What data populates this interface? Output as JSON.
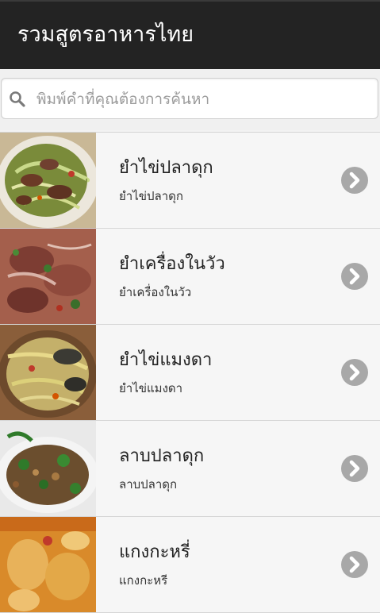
{
  "header": {
    "title": "รวมสูตรอาหารไทย"
  },
  "search": {
    "placeholder": "พิมพ์คำที่คุณต้องการค้นหา",
    "icon": "search-icon"
  },
  "recipes": [
    {
      "title": "ยำไข่ปลาดุก",
      "subtitle": "ยำไข่ปลาดุก"
    },
    {
      "title": "ยำเครื่องในวัว",
      "subtitle": "ยำเครื่องในวัว"
    },
    {
      "title": "ยำไข่แมงดา",
      "subtitle": "ยำไข่แมงดา"
    },
    {
      "title": "ลาบปลาดุก",
      "subtitle": "ลาบปลาดุก"
    },
    {
      "title": "แกงกะหรี่",
      "subtitle": "แกงกะหรี"
    }
  ],
  "colors": {
    "header_bg": "#232323",
    "row_bg": "#f6f6f6",
    "chevron": "#a8a8a8"
  }
}
